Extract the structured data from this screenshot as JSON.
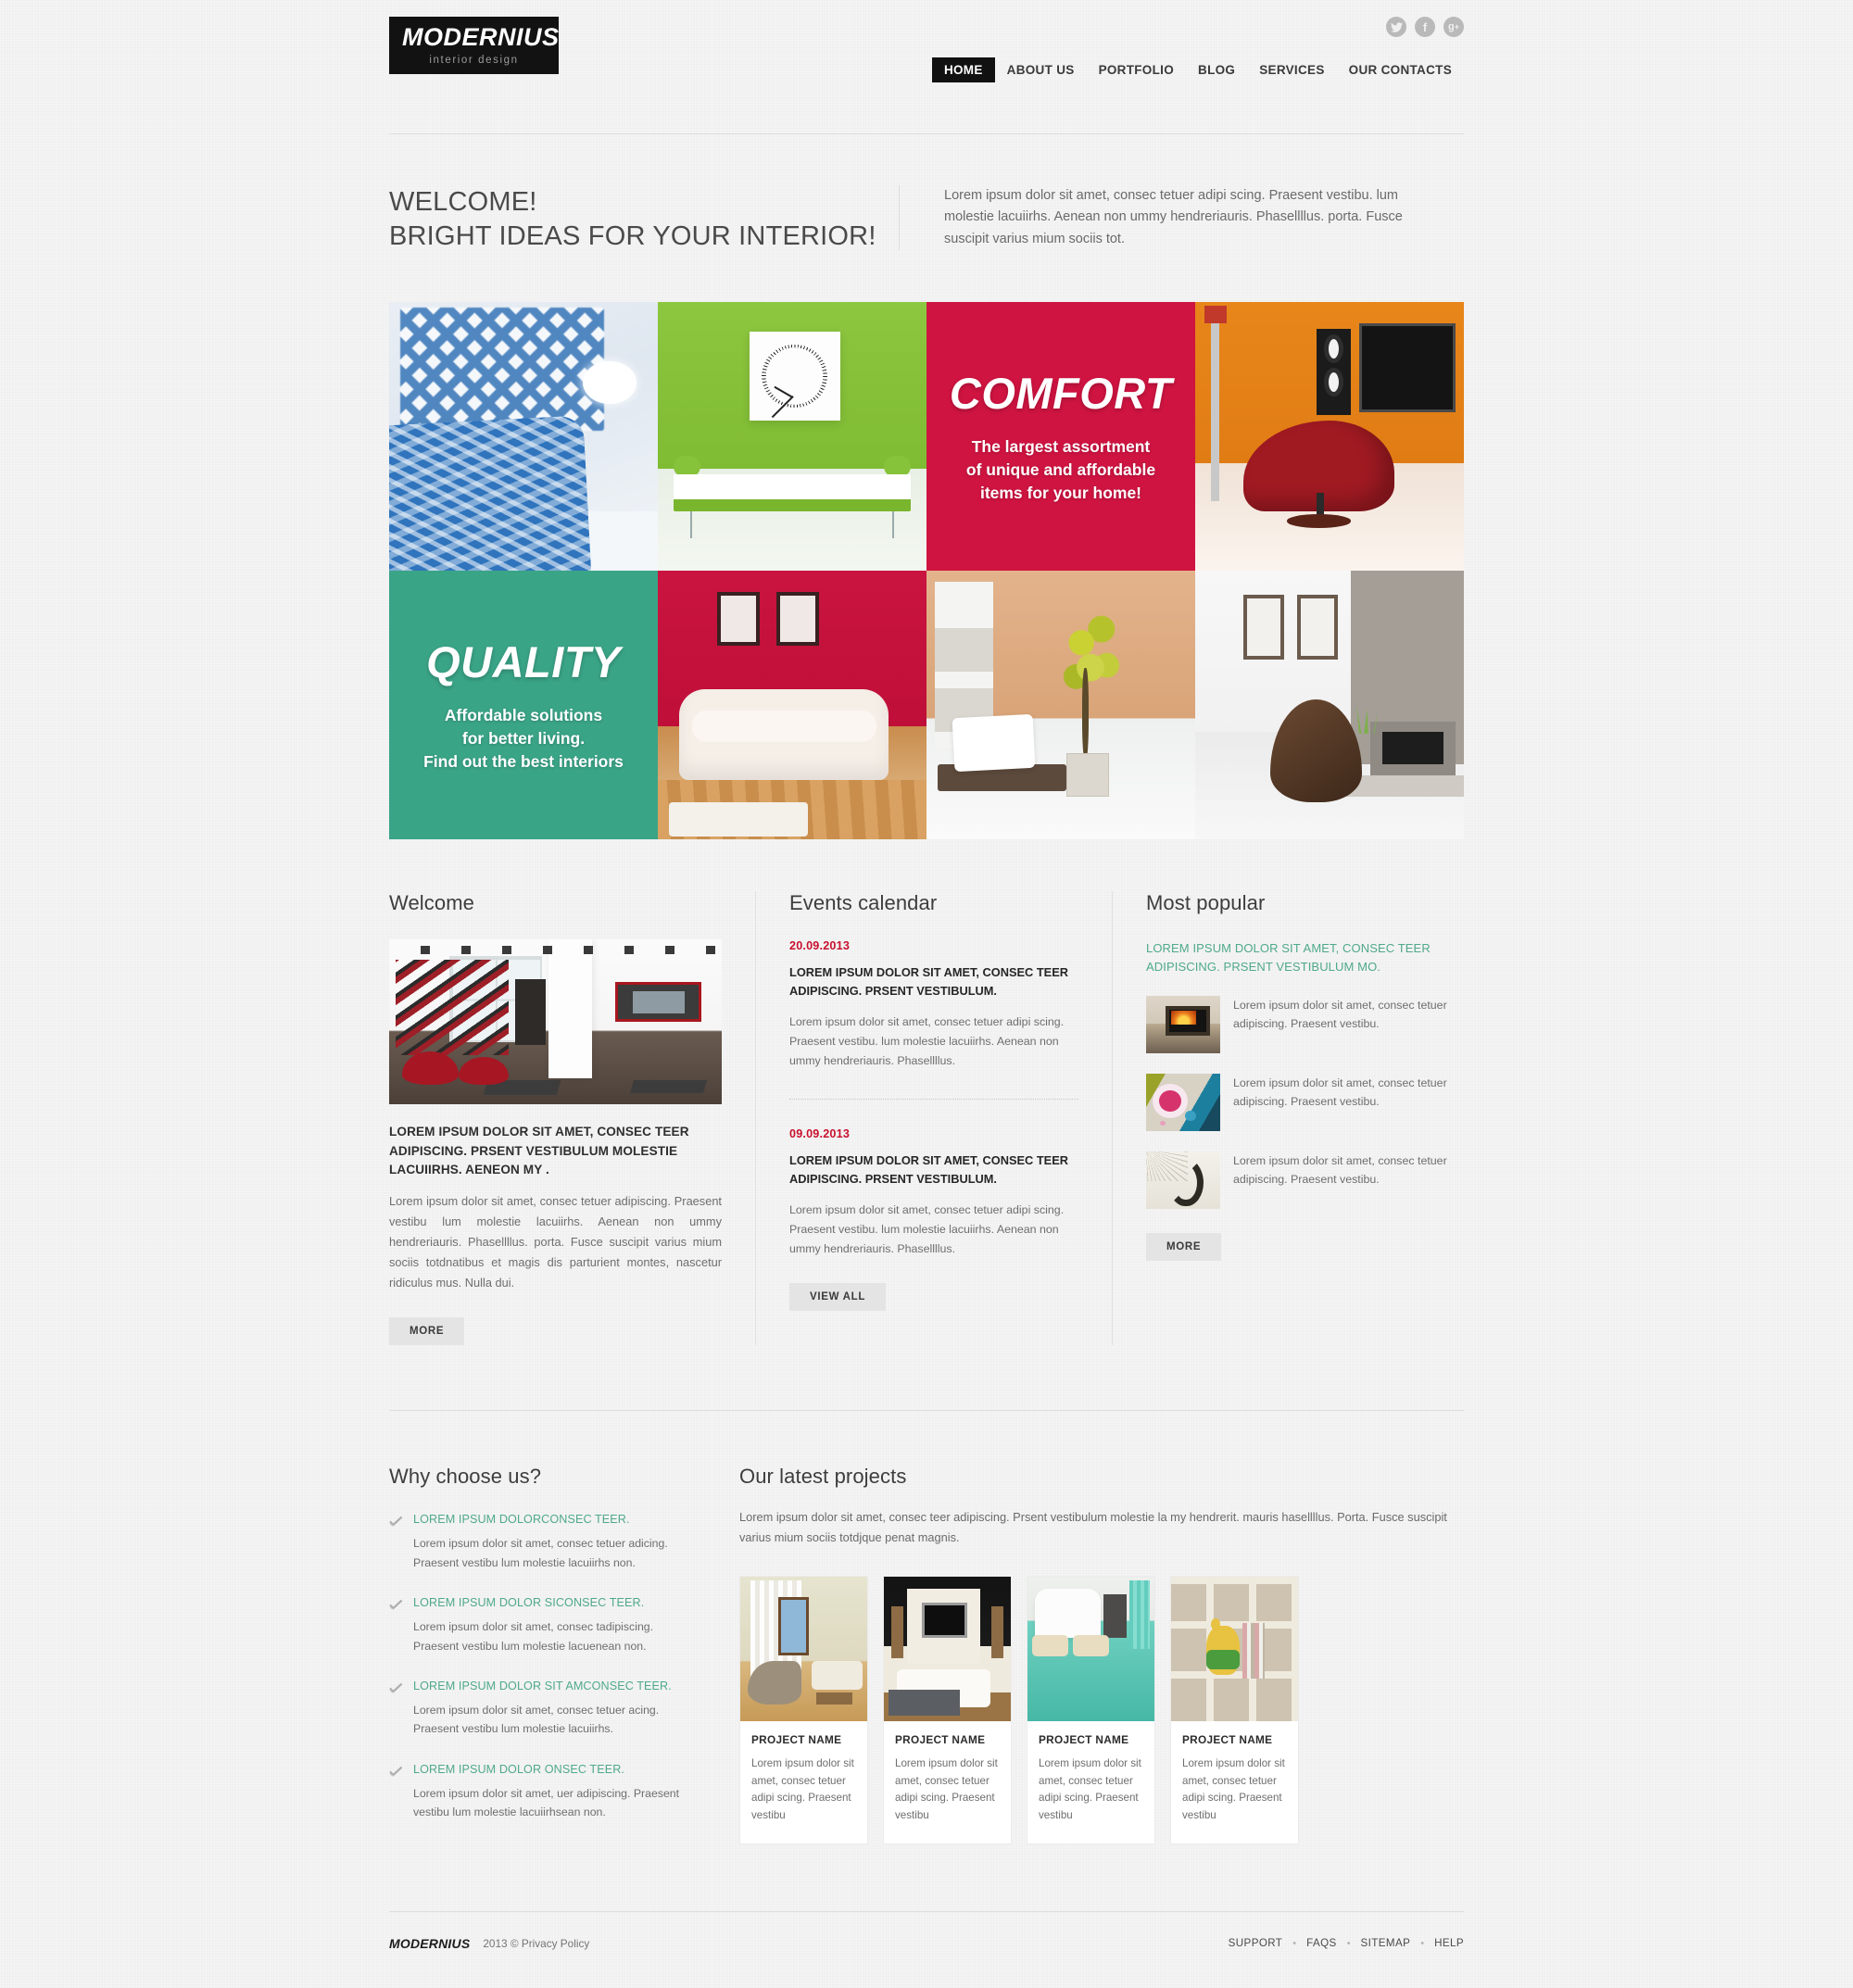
{
  "header": {
    "logo_title": "MODERNIUS",
    "logo_sub": "interior design",
    "social": [
      {
        "name": "twitter-icon",
        "glyph": "t"
      },
      {
        "name": "facebook-icon",
        "glyph": "f"
      },
      {
        "name": "google-plus-icon",
        "glyph": "g+"
      }
    ],
    "nav": [
      {
        "label": "HOME",
        "active": true
      },
      {
        "label": "ABOUT US",
        "active": false
      },
      {
        "label": "PORTFOLIO",
        "active": false
      },
      {
        "label": "BLOG",
        "active": false
      },
      {
        "label": "SERVICES",
        "active": false
      },
      {
        "label": "OUR CONTACTS",
        "active": false
      }
    ]
  },
  "intro": {
    "title_line1": "WELCOME!",
    "title_line2": "BRIGHT IDEAS FOR YOUR INTERIOR!",
    "text": "Lorem ipsum dolor sit amet, consec tetuer adipi scing. Praesent vestibu.  lum molestie lacuiirhs. Aenean non ummy hendreriauris. Phasellllus. porta. Fusce suscipit varius mium sociis tot."
  },
  "gallery": {
    "comfort": {
      "heading": "COMFORT",
      "line1": "The largest assortment",
      "line2": "of unique and affordable",
      "line3": "items for your home!",
      "color": "#cf1441"
    },
    "quality": {
      "heading": "QUALITY",
      "line1": "Affordable solutions",
      "line2": "for better living.",
      "line3": "Find out the best interiors",
      "color": "#3aa487"
    },
    "photos": [
      "blue-pillows-bedroom",
      "green-wall-clock-bench",
      "orange-wall-red-chair-speakers",
      "red-wall-white-sofa",
      "tan-wall-plant-bench",
      "white-room-fireplace-beanbag"
    ]
  },
  "welcome": {
    "title": "Welcome",
    "photo": "modern-loft-staircase-red-chairs",
    "heading": "LOREM IPSUM DOLOR SIT AMET, CONSEC TEER ADIPISCING. PRSENT VESTIBULUM MOLESTIE LACUIIRHS. AENEON MY .",
    "body": "Lorem ipsum dolor sit amet, consec tetuer adipiscing. Praesent vestibu lum molestie lacuiirhs. Aenean non ummy hendreriauris. Phasellllus. porta. Fusce suscipit varius mium sociis totdnatibus et magis dis parturient montes, nascetur ridiculus mus. Nulla dui.",
    "button": "MORE"
  },
  "events": {
    "title": "Events calendar",
    "items": [
      {
        "date": "20.09.2013",
        "title": "LOREM IPSUM DOLOR SIT AMET, CONSEC TEER ADIPISCING. PRSENT VESTIBULUM.",
        "text": "Lorem ipsum dolor sit amet, consec tetuer adipi scing. Praesent vestibu.  lum molestie lacuiirhs. Aenean non ummy hendreriauris. Phasellllus."
      },
      {
        "date": "09.09.2013",
        "title": "LOREM IPSUM DOLOR SIT AMET, CONSEC TEER ADIPISCING. PRSENT VESTIBULUM.",
        "text": "Lorem ipsum dolor sit amet, consec tetuer adipi scing. Praesent vestibu.  lum molestie lacuiirhs. Aenean non ummy hendreriauris. Phasellllus."
      }
    ],
    "button": "VIEW ALL"
  },
  "popular": {
    "title": "Most popular",
    "link": "LOREM IPSUM DOLOR SIT AMET, CONSEC TEER ADIPISCING. PRSENT VESTIBULUM MO.",
    "link_color": "#4fa98a",
    "items": [
      {
        "thumb": "fireplace-photo",
        "text": "Lorem ipsum dolor sit amet, consec tetuer adipiscing. Praesent vestibu."
      },
      {
        "thumb": "floral-pillow-photo",
        "text": "Lorem ipsum dolor sit amet, consec tetuer adipiscing. Praesent vestibu."
      },
      {
        "thumb": "sculpture-photo",
        "text": "Lorem ipsum dolor sit amet, consec tetuer adipiscing. Praesent vestibu."
      }
    ],
    "button": "MORE"
  },
  "why": {
    "title": "Why choose us?",
    "items": [
      {
        "title": "LOREM IPSUM DOLORCONSEC TEER.",
        "text": "Lorem ipsum dolor sit amet, consec tetuer adicing. Praesent vestibu lum molestie lacuiirhs non."
      },
      {
        "title": "LOREM IPSUM DOLOR SICONSEC TEER.",
        "text": "Lorem ipsum dolor sit amet, consec tadipiscing. Praesent vestibu lum molestie lacuenean non."
      },
      {
        "title": "LOREM IPSUM DOLOR SIT AMCONSEC TEER.",
        "text": "Lorem ipsum dolor sit amet, consec tetuer acing. Praesent vestibu lum molestie lacuiirhs."
      },
      {
        "title": "LOREM IPSUM DOLOR ONSEC TEER.",
        "text": "Lorem ipsum dolor sit amet, uer adipiscing. Praesent vestibu lum molestie lacuiirhsean non."
      }
    ]
  },
  "projects": {
    "title": "Our latest projects",
    "intro": "Lorem ipsum dolor sit amet, consec teer adipiscing. Prsent vestibulum molestie la my hendrerit. mauris hasellllus. Porta. Fusce suscipit varius mium sociis totdjque penat magnis.",
    "items": [
      {
        "name": "PROJECT NAME",
        "text": "Lorem ipsum dolor sit amet, consec tetuer adipi scing. Praesent vestibu",
        "img": "living-room-curved-chairs"
      },
      {
        "name": "PROJECT NAME",
        "text": "Lorem ipsum dolor sit amet, consec tetuer adipi scing. Praesent vestibu",
        "img": "black-wall-tv-media-room"
      },
      {
        "name": "PROJECT NAME",
        "text": "Lorem ipsum dolor sit amet, consec tetuer adipi scing. Praesent vestibu",
        "img": "turquoise-bedroom"
      },
      {
        "name": "PROJECT NAME",
        "text": "Lorem ipsum dolor sit amet, consec tetuer adipi scing. Praesent vestibu",
        "img": "kids-shelving-teddy-bear"
      }
    ]
  },
  "footer": {
    "logo": "MODERNIUS",
    "copyright": "2013 © Privacy Policy",
    "links": [
      "SUPPORT",
      "FAQS",
      "SITEMAP",
      "HELP"
    ]
  }
}
